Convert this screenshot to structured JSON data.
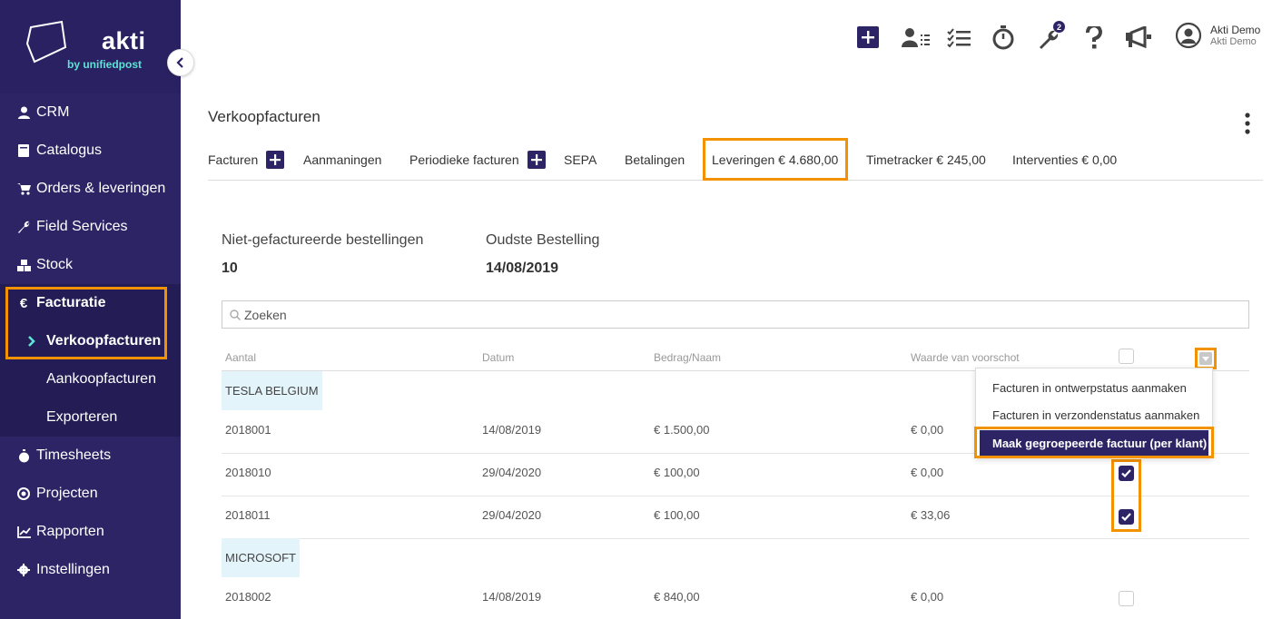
{
  "brand": {
    "name": "akti",
    "sub": "by unifiedpost"
  },
  "sidebar": {
    "items": [
      {
        "label": "CRM",
        "icon": "user-icon"
      },
      {
        "label": "Catalogus",
        "icon": "book-icon"
      },
      {
        "label": "Orders & leveringen",
        "icon": "cart-icon"
      },
      {
        "label": "Field Services",
        "icon": "wrench-icon"
      },
      {
        "label": "Stock",
        "icon": "cubes-icon"
      },
      {
        "label": "Facturatie",
        "icon": "euro-icon"
      },
      {
        "label": "Timesheets",
        "icon": "stopwatch-icon"
      },
      {
        "label": "Projecten",
        "icon": "target-icon"
      },
      {
        "label": "Rapporten",
        "icon": "chart-icon"
      },
      {
        "label": "Instellingen",
        "icon": "gear-icon"
      }
    ],
    "facturatie_sub": [
      "Verkoopfacturen",
      "Aankoopfacturen",
      "Exporteren"
    ]
  },
  "topbar": {
    "tools_badge": "2",
    "user_name": "Akti Demo",
    "user_company": "Akti Demo"
  },
  "page": {
    "title": "Verkoopfacturen",
    "tabs": [
      "Facturen",
      "Aanmaningen",
      "Periodieke facturen",
      "SEPA",
      "Betalingen",
      "Leveringen € 4.680,00",
      "Timetracker € 245,00",
      "Interventies € 0,00"
    ],
    "stats": {
      "unbilled_label": "Niet-gefactureerde bestellingen",
      "unbilled_value": "10",
      "oldest_label": "Oudste Bestelling",
      "oldest_value": "14/08/2019"
    },
    "search_placeholder": "Zoeken"
  },
  "table": {
    "headers": [
      "Aantal",
      "Datum",
      "Bedrag/Naam",
      "Waarde van voorschot"
    ],
    "groups": [
      {
        "name": "TESLA BELGIUM",
        "rows": [
          {
            "number": "2018001",
            "date": "14/08/2019",
            "amount": "€ 1.500,00",
            "advance": "€ 0,00",
            "checked": false
          },
          {
            "number": "2018010",
            "date": "29/04/2020",
            "amount": "€ 100,00",
            "advance": "€ 0,00",
            "checked": true
          },
          {
            "number": "2018011",
            "date": "29/04/2020",
            "amount": "€ 100,00",
            "advance": "€ 33,06",
            "checked": true
          }
        ]
      },
      {
        "name": "MICROSOFT",
        "rows": [
          {
            "number": "2018002",
            "date": "14/08/2019",
            "amount": "€ 840,00",
            "advance": "€ 0,00",
            "checked": false
          }
        ]
      }
    ]
  },
  "dropdown": {
    "items": [
      "Facturen in ontwerpstatus aanmaken",
      "Facturen in verzondenstatus aanmaken",
      "Maak gegroepeerde factuur (per klant)"
    ]
  },
  "colors": {
    "primary": "#2d2466",
    "highlight": "#f39200",
    "group_bg": "#e3f4fb",
    "logo_accent": "#5ee3d4"
  }
}
